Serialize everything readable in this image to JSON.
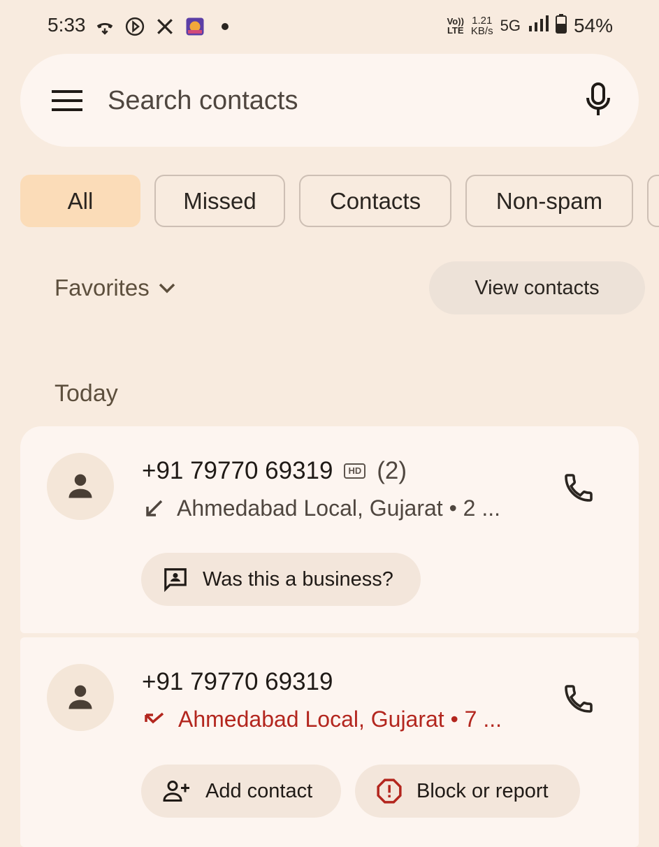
{
  "status_bar": {
    "time": "5:33",
    "volte_top": "Vo))",
    "volte_bottom": "LTE",
    "speed_top": "1.21",
    "speed_bottom": "KB/s",
    "network": "5G",
    "battery": "54%"
  },
  "search": {
    "placeholder": "Search contacts"
  },
  "filters": [
    {
      "label": "All",
      "selected": true
    },
    {
      "label": "Missed",
      "selected": false
    },
    {
      "label": "Contacts",
      "selected": false
    },
    {
      "label": "Non-spam",
      "selected": false
    }
  ],
  "favorites": {
    "label": "Favorites",
    "view_contacts": "View contacts"
  },
  "section": {
    "today": "Today"
  },
  "calls": [
    {
      "number": "+91 79770 69319",
      "hd": "HD",
      "count": "(2)",
      "detail": "Ahmedabad Local, Gujarat • 2 ...",
      "type": "incoming",
      "action_label": "Was this a business?"
    },
    {
      "number": "+91 79770 69319",
      "detail": "Ahmedabad Local, Gujarat • 7 ...",
      "type": "missed",
      "action_add": "Add contact",
      "action_block": "Block or report"
    }
  ],
  "colors": {
    "background": "#f8ebdf",
    "selected_chip": "#fbdcb8",
    "missed": "#b3261e"
  }
}
